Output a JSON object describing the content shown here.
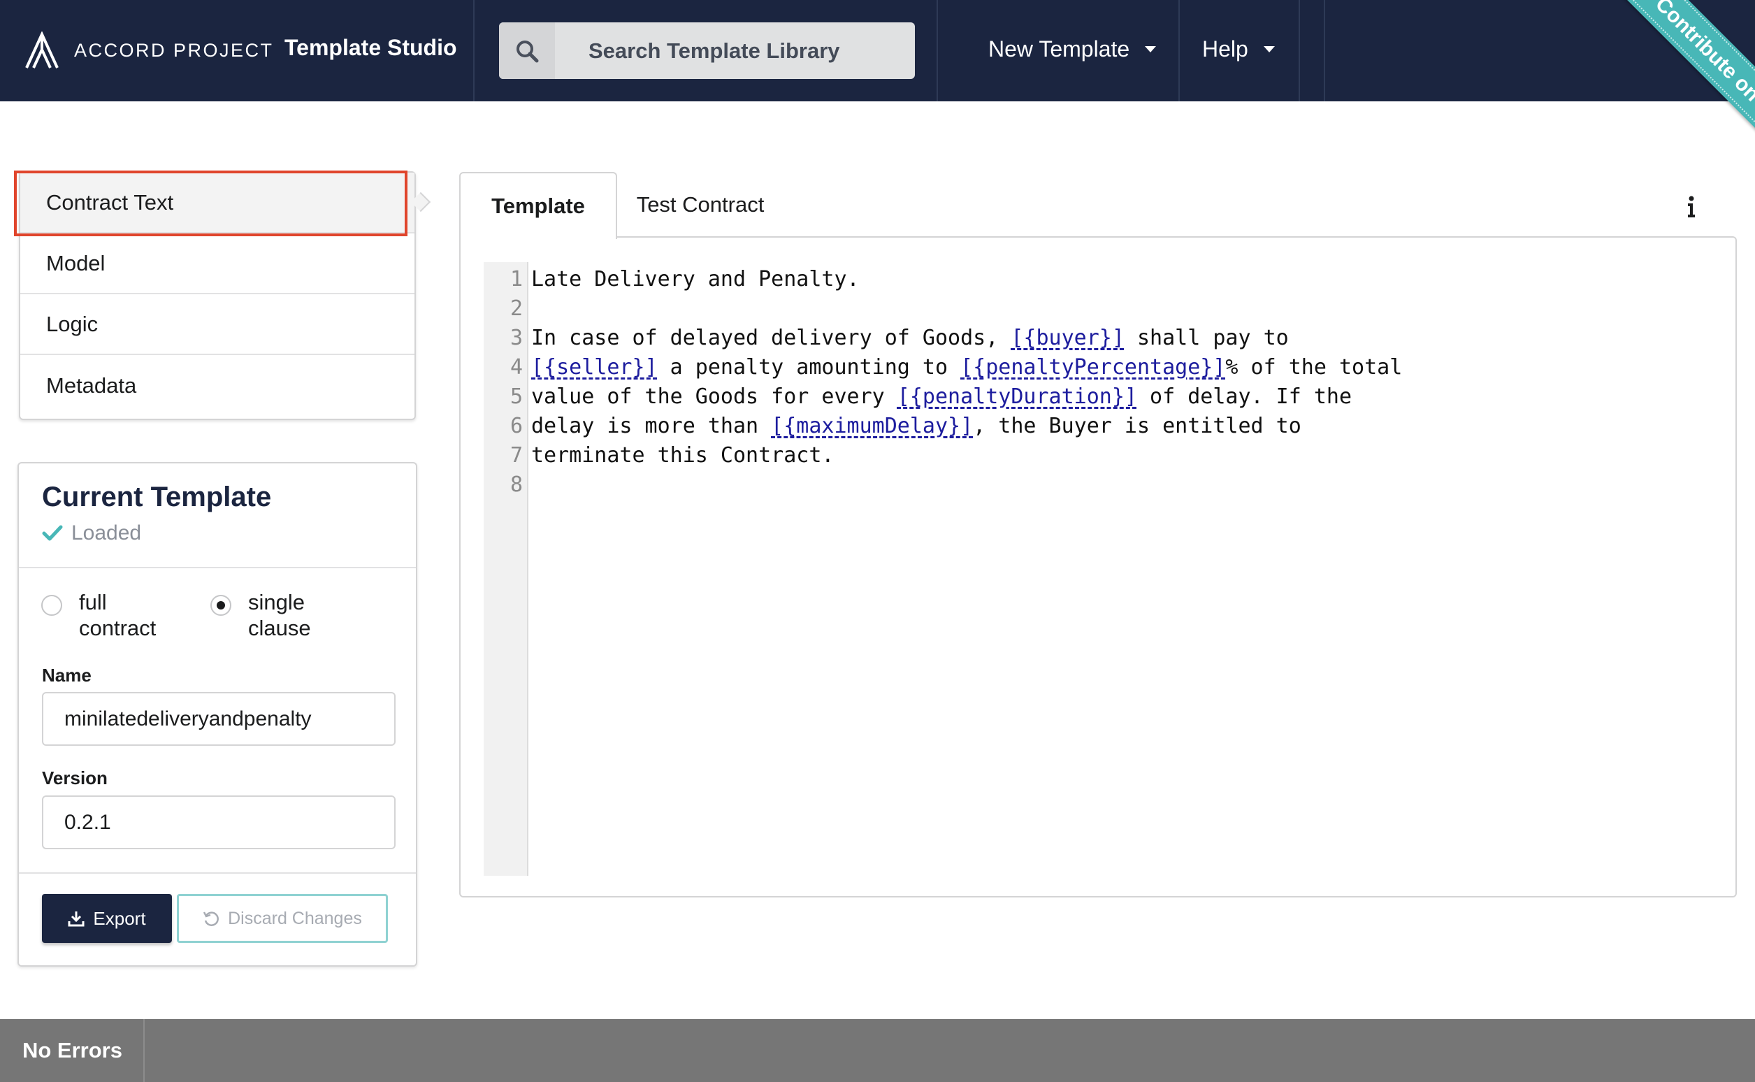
{
  "header": {
    "logo_text": "ACCORD PROJECT",
    "app_title": "Template Studio",
    "search_label": "Search Template Library",
    "menu": [
      {
        "label": "New Template"
      },
      {
        "label": "Help"
      }
    ],
    "ribbon": "Contribute on GitHub"
  },
  "nav": {
    "items": [
      {
        "label": "Contract Text",
        "active": true
      },
      {
        "label": "Model"
      },
      {
        "label": "Logic"
      },
      {
        "label": "Metadata"
      }
    ]
  },
  "current_template": {
    "title": "Current Template",
    "status": "Loaded",
    "radios": [
      {
        "label": "full contract",
        "checked": false
      },
      {
        "label": "single clause",
        "checked": true
      }
    ],
    "name_label": "Name",
    "name_value": "minilatedeliveryandpenalty",
    "version_label": "Version",
    "version_value": "0.2.1",
    "export_label": "Export",
    "discard_label": "Discard Changes"
  },
  "editor": {
    "tabs": [
      {
        "label": "Template",
        "active": true
      },
      {
        "label": "Test Contract"
      }
    ],
    "lines": [
      {
        "n": "1",
        "parts": [
          {
            "t": "Late Delivery and Penalty."
          }
        ]
      },
      {
        "n": "2",
        "parts": [
          {
            "t": ""
          }
        ]
      },
      {
        "n": "3",
        "parts": [
          {
            "t": "In case of delayed delivery of Goods, "
          },
          {
            "t": "[{buyer}]",
            "var": true
          },
          {
            "t": " shall pay to"
          }
        ]
      },
      {
        "n": "4",
        "parts": [
          {
            "t": "[{seller}]",
            "var": true
          },
          {
            "t": " a penalty amounting to "
          },
          {
            "t": "[{penaltyPercentage}]",
            "var": true
          },
          {
            "t": "% of the total"
          }
        ]
      },
      {
        "n": "5",
        "parts": [
          {
            "t": "value of the Goods for every "
          },
          {
            "t": "[{penaltyDuration}]",
            "var": true
          },
          {
            "t": " of delay. If the"
          }
        ]
      },
      {
        "n": "6",
        "parts": [
          {
            "t": "delay is more than "
          },
          {
            "t": "[{maximumDelay}]",
            "var": true
          },
          {
            "t": ", the Buyer is entitled to"
          }
        ]
      },
      {
        "n": "7",
        "parts": [
          {
            "t": "terminate this Contract."
          }
        ]
      },
      {
        "n": "8",
        "parts": [
          {
            "t": ""
          }
        ]
      }
    ]
  },
  "footer": {
    "status": "No Errors"
  },
  "icons": {
    "search": "search-icon",
    "info": "info-icon",
    "check": "check-icon",
    "download": "download-icon",
    "undo": "undo-icon"
  },
  "colors": {
    "header_bg": "#1b2540",
    "ribbon": "#48b7b7",
    "highlight": "#e0452c",
    "variable_link": "#1d1d9e",
    "footer_bg": "#767676"
  }
}
